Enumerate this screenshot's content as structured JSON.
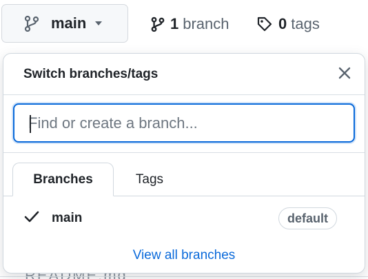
{
  "toolbar": {
    "branch_button_label": "main",
    "branches_count": "1",
    "branches_label": "branch",
    "tags_count": "0",
    "tags_label": "tags"
  },
  "dropdown": {
    "title": "Switch branches/tags",
    "filter_placeholder": "Find or create a branch...",
    "filter_value": "",
    "tabs": [
      {
        "label": "Branches",
        "active": true
      },
      {
        "label": "Tags",
        "active": false
      }
    ],
    "branches": [
      {
        "name": "main",
        "selected": true,
        "badge": "default"
      }
    ],
    "view_all_label": "View all branches"
  },
  "background": {
    "peek_text": "README.md"
  },
  "colors": {
    "accent": "#0969da",
    "text": "#1f2328",
    "muted": "#59636e",
    "border": "#d0d7de",
    "button_bg": "#f6f8fa"
  },
  "icons": {
    "branch_button": "git-branch-icon",
    "dropdown_caret": "triangle-down-icon",
    "branches_link": "git-branch-icon",
    "tags_link": "tag-icon",
    "close": "x-icon",
    "selected": "check-icon"
  }
}
